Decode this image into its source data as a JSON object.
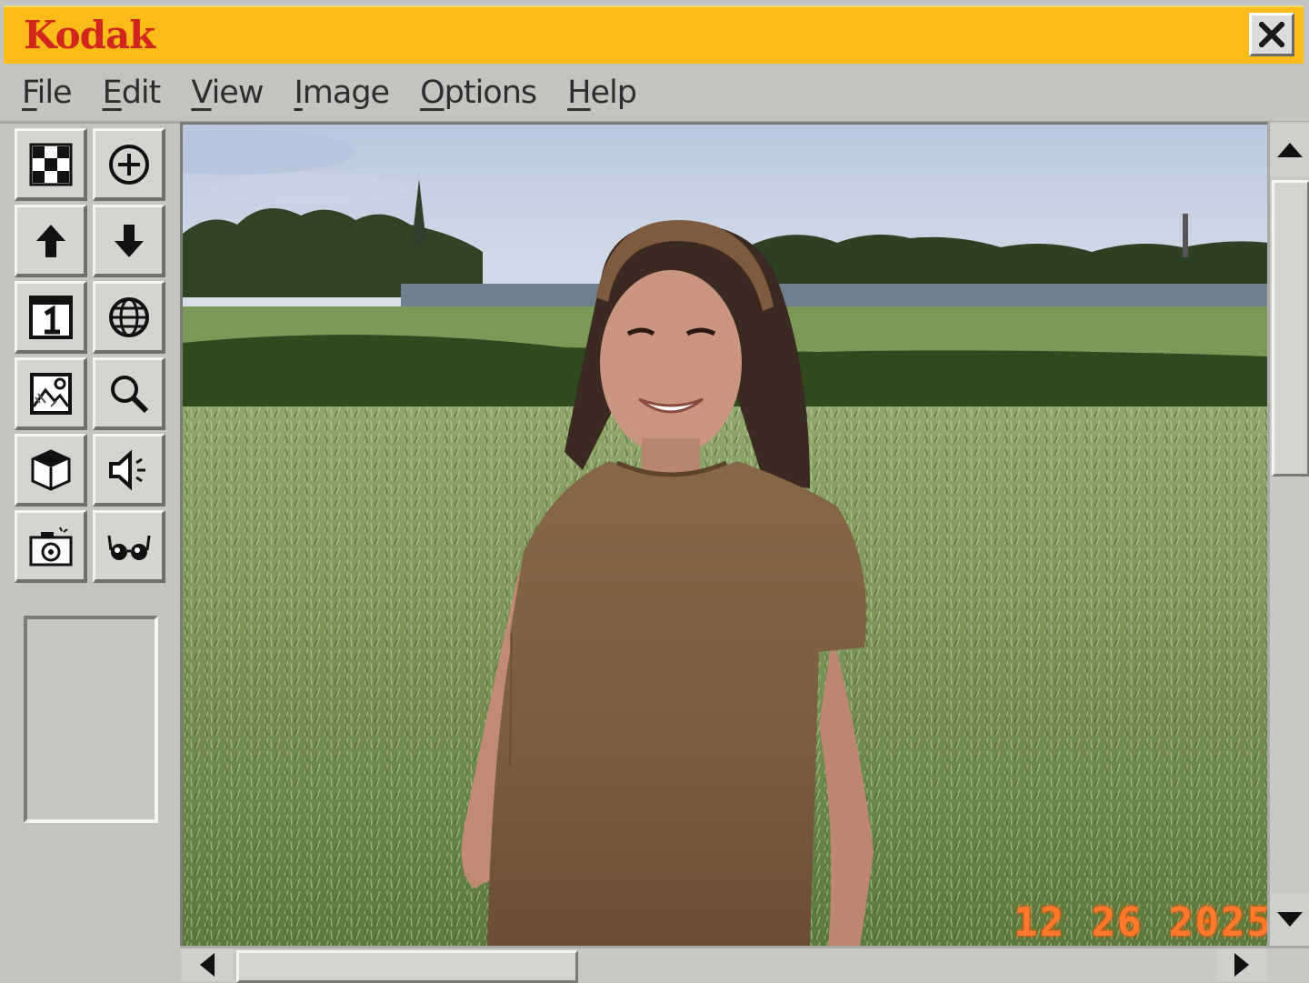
{
  "window": {
    "brand": "Kodak",
    "close_label": "×"
  },
  "menu": [
    {
      "first": "F",
      "rest": "ile"
    },
    {
      "first": "E",
      "rest": "dit"
    },
    {
      "first": "V",
      "rest": "iew"
    },
    {
      "first": "I",
      "rest": "mage"
    },
    {
      "first": "O",
      "rest": "ptions"
    },
    {
      "first": "H",
      "rest": "elp"
    }
  ],
  "tools": [
    {
      "name": "checkerboard-icon"
    },
    {
      "name": "zoom-in-plus-icon"
    },
    {
      "name": "arrow-up-icon"
    },
    {
      "name": "arrow-down-icon"
    },
    {
      "name": "frame-one-icon"
    },
    {
      "name": "globe-icon"
    },
    {
      "name": "picture-icon"
    },
    {
      "name": "magnifier-icon"
    },
    {
      "name": "cube-icon"
    },
    {
      "name": "speaker-icon"
    },
    {
      "name": "camera-icon"
    },
    {
      "name": "glasses-icon"
    }
  ],
  "photo": {
    "date_stamp": "12 26 2025"
  },
  "colors": {
    "titlebar": "#fbbc1a",
    "brand": "#d0261c",
    "chrome": "#c3c3c0",
    "date_stamp": "#ff7a2b"
  }
}
